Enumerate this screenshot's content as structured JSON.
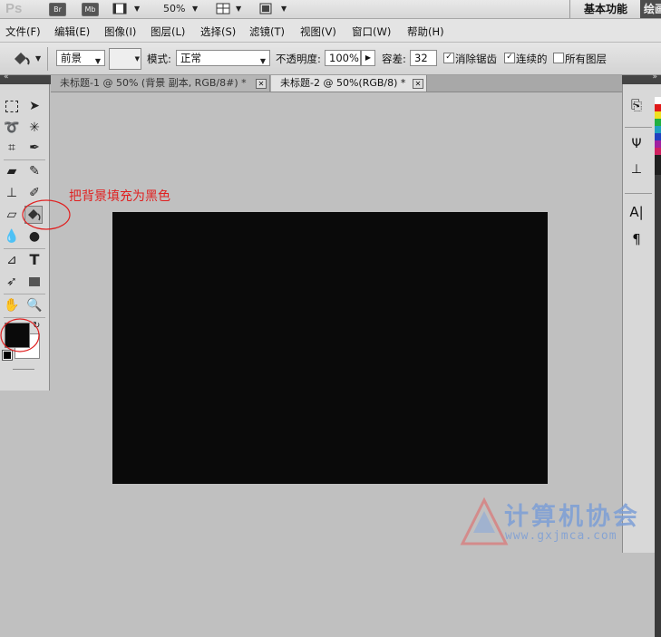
{
  "appbar": {
    "logo": "Ps",
    "bridge_chip": "Br",
    "minibridge_chip": "Mb",
    "zoom_value": "50%",
    "workspace_basic": "基本功能",
    "workspace_other": "绘画"
  },
  "menu": [
    "文件(F)",
    "编辑(E)",
    "图像(I)",
    "图层(L)",
    "选择(S)",
    "滤镜(T)",
    "视图(V)",
    "窗口(W)",
    "帮助(H)"
  ],
  "options": {
    "fill_source": "前景",
    "mode_label": "模式:",
    "mode_value": "正常",
    "opacity_label": "不透明度:",
    "opacity_value": "100%",
    "tolerance_label": "容差:",
    "tolerance_value": "32",
    "antialias_label": "消除锯齿",
    "contiguous_label": "连续的",
    "all_layers_label": "所有图层"
  },
  "tabs": [
    {
      "label": "未标题-1 @ 50% (背景 副本, RGB/8#) *"
    },
    {
      "label": "未标题-2 @ 50%(RGB/8) *"
    }
  ],
  "annotation": {
    "text": "把背景填充为黑色",
    "color": "#e02020"
  },
  "colors": {
    "foreground": "#0a0a0a",
    "background": "#ffffff",
    "canvas": "#0a0a0a",
    "workspace": "#c0c0c0"
  },
  "watermark": {
    "brand": "计算机协会",
    "url": "www.gxjmca.com"
  }
}
